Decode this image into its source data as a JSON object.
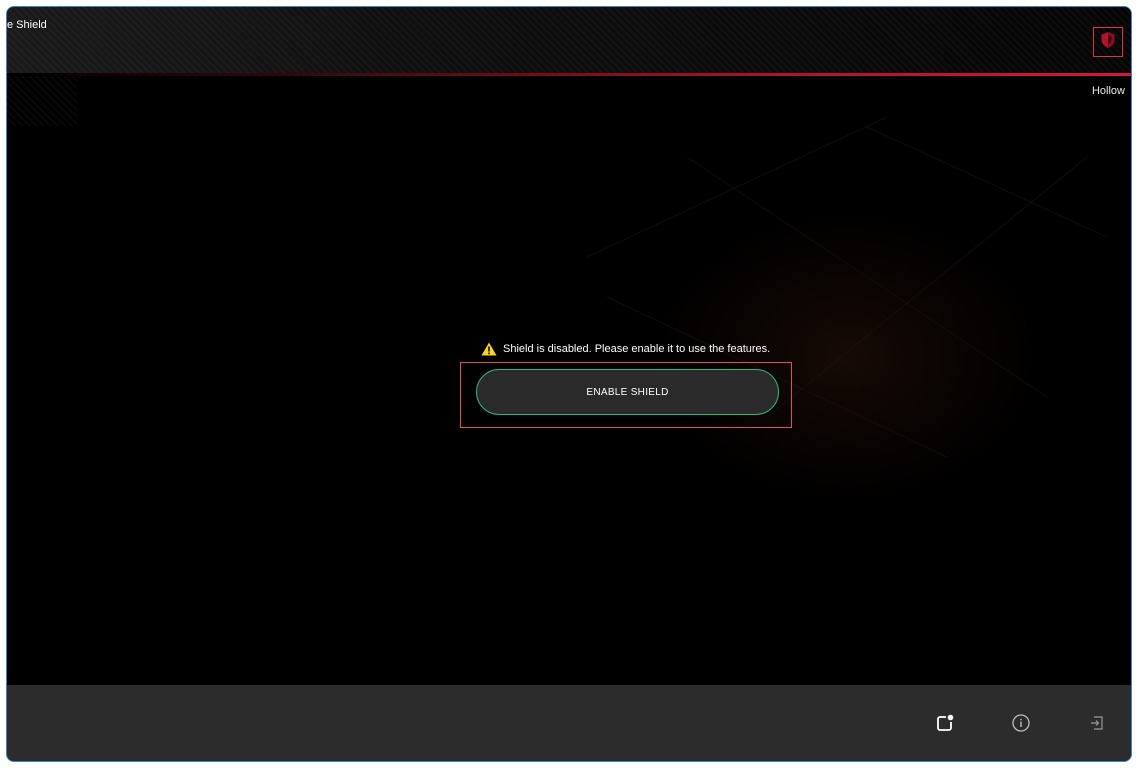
{
  "window": {
    "title": "e Shield",
    "profile_name": "Hollow"
  },
  "header": {
    "shield_icon": "shield-icon"
  },
  "main": {
    "warning_icon": "warning-icon",
    "warning_text": "Shield is disabled. Please enable it to use the features.",
    "enable_button_label": "ENABLE SHIELD"
  },
  "footer": {
    "icons": [
      "notification-icon",
      "info-icon",
      "exit-icon"
    ]
  },
  "colors": {
    "accent_red": "#d4183a",
    "button_border_green": "#27b884",
    "highlight_outline": "#e05050",
    "warning_yellow": "#f5d90a",
    "footer_bg": "#2c2c2c"
  }
}
